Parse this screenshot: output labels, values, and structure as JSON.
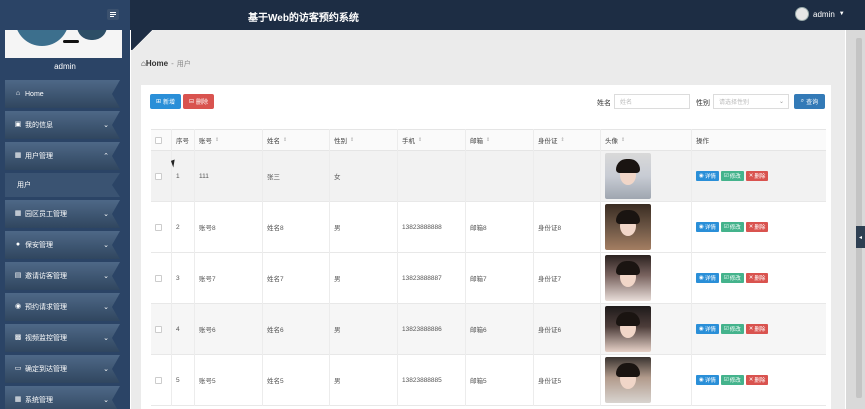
{
  "header": {
    "title": "基于Web的访客预约系统",
    "user": "admin"
  },
  "sidebar": {
    "profile_name": "admin",
    "items": [
      {
        "label": "Home",
        "icon": "home-icon",
        "chevron": ""
      },
      {
        "label": "我的信息",
        "icon": "profile-icon",
        "chevron": "⌄"
      },
      {
        "label": "用户管理",
        "icon": "grid-icon",
        "chevron": "⌃"
      },
      {
        "label": "用户",
        "icon": "",
        "chevron": ""
      },
      {
        "label": "园区员工管理",
        "icon": "grid-icon",
        "chevron": "⌄"
      },
      {
        "label": "保安管理",
        "icon": "user-icon",
        "chevron": "⌄"
      },
      {
        "label": "邀请访客管理",
        "icon": "calendar-icon",
        "chevron": "⌄"
      },
      {
        "label": "预约请求管理",
        "icon": "bulb-icon",
        "chevron": "⌄"
      },
      {
        "label": "视频监控管理",
        "icon": "briefcase-icon",
        "chevron": "⌄"
      },
      {
        "label": "确定到达管理",
        "icon": "monitor-icon",
        "chevron": "⌄"
      },
      {
        "label": "系统管理",
        "icon": "grid-icon",
        "chevron": "⌄"
      }
    ]
  },
  "breadcrumb": {
    "home": "Home",
    "sep": "-",
    "current": "用户"
  },
  "toolbar": {
    "add_label": "新增",
    "delete_label": "删除",
    "name_label": "姓名",
    "name_placeholder": "姓名",
    "gender_label": "性别",
    "gender_placeholder": "请选择性别",
    "search_label": "查询"
  },
  "table": {
    "headers": [
      "序号",
      "账号",
      "姓名",
      "性别",
      "手机",
      "邮箱",
      "身份证",
      "头像",
      "操作"
    ],
    "rows": [
      {
        "no": "1",
        "account": "111",
        "name": "张三",
        "gender": "女",
        "phone": "",
        "email": "",
        "idcard": ""
      },
      {
        "no": "2",
        "account": "账号8",
        "name": "姓名8",
        "gender": "男",
        "phone": "13823888888",
        "email": "邮箱8",
        "idcard": "身份证8"
      },
      {
        "no": "3",
        "account": "账号7",
        "name": "姓名7",
        "gender": "男",
        "phone": "13823888887",
        "email": "邮箱7",
        "idcard": "身份证7"
      },
      {
        "no": "4",
        "account": "账号6",
        "name": "姓名6",
        "gender": "男",
        "phone": "13823888886",
        "email": "邮箱6",
        "idcard": "身份证6"
      },
      {
        "no": "5",
        "account": "账号5",
        "name": "姓名5",
        "gender": "男",
        "phone": "13823888885",
        "email": "邮箱5",
        "idcard": "身份证5"
      }
    ],
    "actions": {
      "detail": "详情",
      "edit": "修改",
      "delete": "删除"
    }
  },
  "colors": {
    "topbar": "#1d2d44",
    "sidebar": "#2b4466",
    "primary": "#2a8fd8",
    "danger": "#d9534f",
    "success": "#44b38c"
  }
}
